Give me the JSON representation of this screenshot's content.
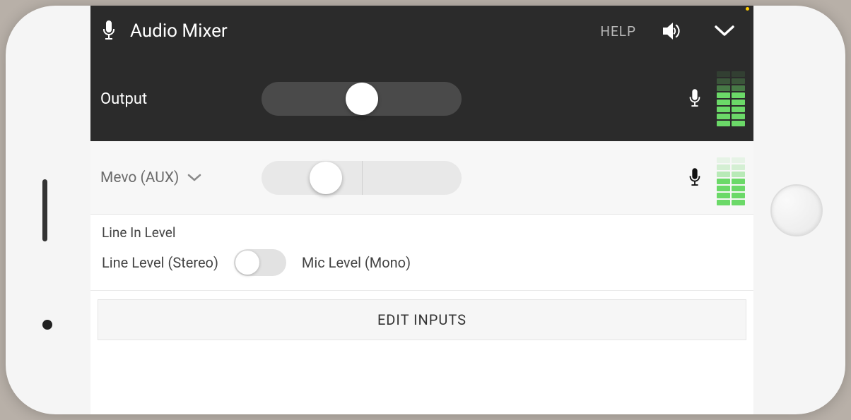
{
  "header": {
    "title": "Audio Mixer",
    "help_label": "HELP"
  },
  "output": {
    "label": "Output",
    "slider_position_pct": 50
  },
  "input": {
    "label": "Mevo (AUX)",
    "slider_position_pct": 32
  },
  "line_in": {
    "heading": "Line In Level",
    "left_label": "Line Level (Stereo)",
    "right_label": "Mic Level (Mono)",
    "toggle_on": false
  },
  "edit_inputs_label": "EDIT INPUTS",
  "icons": {
    "header_mic": "microphone-icon",
    "speaker": "speaker-icon",
    "chevron_down_header": "chevron-down-icon",
    "output_mic": "microphone-icon",
    "input_mic": "microphone-icon",
    "input_chevron": "chevron-down-icon"
  },
  "colors": {
    "meter_green": "#6bd968",
    "dark_bg": "#2b2b2b"
  }
}
